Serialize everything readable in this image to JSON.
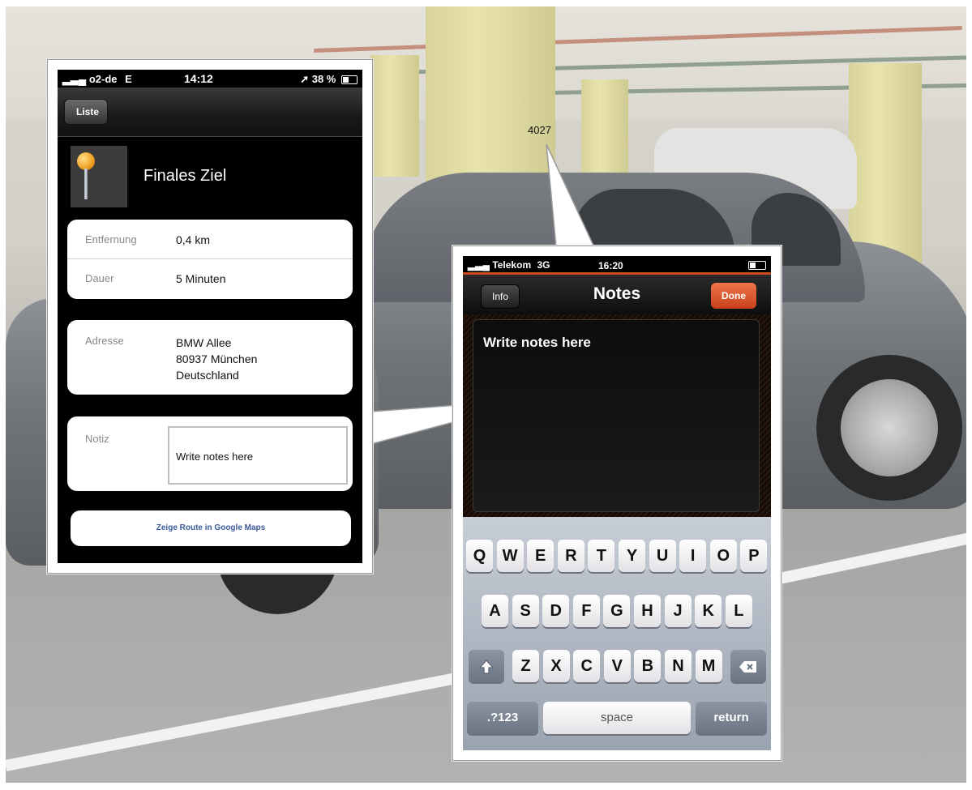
{
  "annotation": {
    "reference_number": "4027"
  },
  "left_phone": {
    "status_bar": {
      "carrier": "o2-de",
      "network": "E",
      "time": "14:12",
      "battery": "38 %"
    },
    "nav": {
      "back_label": "Liste"
    },
    "destination": {
      "title": "Finales Ziel",
      "icon": "map-pin-icon"
    },
    "details": [
      {
        "label": "Entfernung",
        "value": "0,4 km"
      },
      {
        "label": "Dauer",
        "value": "5 Minuten"
      }
    ],
    "address": {
      "label": "Adresse",
      "line1": "BMW Allee",
      "line2": "80937 München",
      "line3": "Deutschland"
    },
    "note": {
      "label": "Notiz",
      "placeholder": "Write notes here"
    },
    "route_button": "Zeige Route in Google Maps"
  },
  "right_phone": {
    "status_bar": {
      "carrier": "Telekom",
      "network": "3G",
      "time": "16:20"
    },
    "nav": {
      "back_label": "Info",
      "title": "Notes",
      "done_label": "Done"
    },
    "notes": {
      "placeholder": "Write notes here"
    },
    "keyboard": {
      "row1": [
        "Q",
        "W",
        "E",
        "R",
        "T",
        "Y",
        "U",
        "I",
        "O",
        "P"
      ],
      "row2": [
        "A",
        "S",
        "D",
        "F",
        "G",
        "H",
        "J",
        "K",
        "L"
      ],
      "row3": [
        "Z",
        "X",
        "C",
        "V",
        "B",
        "N",
        "M"
      ],
      "shift_icon": "shift-icon",
      "delete_icon": "delete-icon",
      "numbers_label": ".?123",
      "space_label": "space",
      "return_label": "return",
      "accent_color": "#c8401a"
    }
  }
}
